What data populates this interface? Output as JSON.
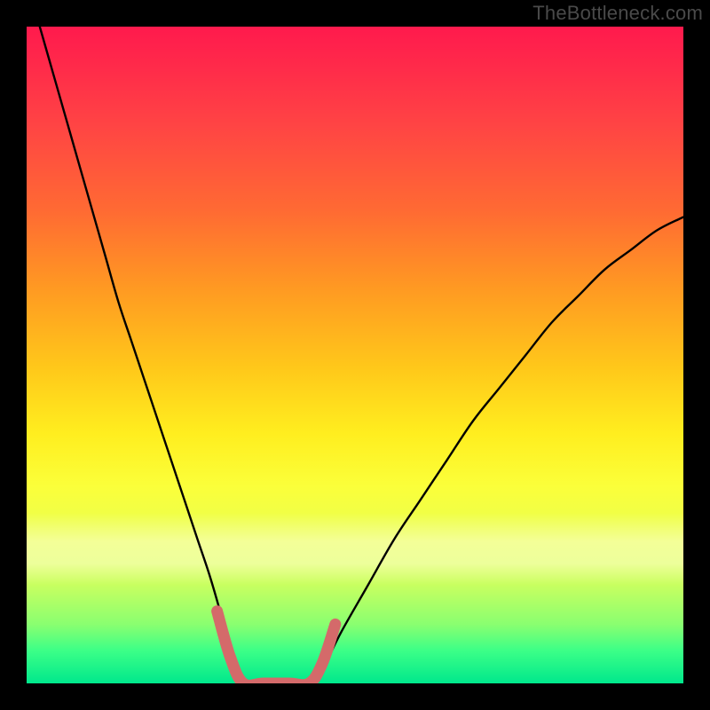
{
  "watermark": "TheBottleneck.com",
  "colors": {
    "curve": "#000000",
    "highlight": "#d46a6a"
  },
  "chart_data": {
    "type": "line",
    "title": "",
    "xlabel": "",
    "ylabel": "",
    "xlim": [
      0,
      100
    ],
    "ylim": [
      0,
      100
    ],
    "grid": false,
    "series": [
      {
        "name": "left-curve",
        "x": [
          2,
          4,
          6,
          8,
          10,
          12,
          14,
          16,
          18,
          20,
          22,
          24,
          26,
          28,
          30,
          31,
          32,
          33
        ],
        "y": [
          100,
          93,
          86,
          79,
          72,
          65,
          58,
          52,
          46,
          40,
          34,
          28,
          22,
          16,
          9,
          5,
          2,
          0
        ]
      },
      {
        "name": "floor",
        "x": [
          33,
          36,
          40,
          44
        ],
        "y": [
          0,
          0,
          0,
          0
        ]
      },
      {
        "name": "right-curve",
        "x": [
          44,
          46,
          48,
          52,
          56,
          60,
          64,
          68,
          72,
          76,
          80,
          84,
          88,
          92,
          96,
          100
        ],
        "y": [
          0,
          4,
          8,
          15,
          22,
          28,
          34,
          40,
          45,
          50,
          55,
          59,
          63,
          66,
          69,
          71
        ]
      },
      {
        "name": "highlight-segment",
        "x": [
          29,
          31,
          33,
          36,
          40,
          43,
          45,
          47
        ],
        "y": [
          11,
          4,
          0,
          0,
          0,
          0,
          3,
          9
        ]
      }
    ]
  }
}
